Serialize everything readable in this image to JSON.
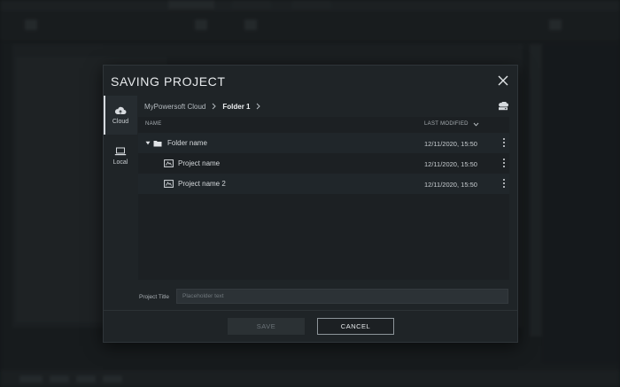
{
  "dialog": {
    "title": "SAVING PROJECT"
  },
  "sidebar": {
    "items": [
      {
        "label": "Cloud",
        "icon": "cloud-icon",
        "active": true
      },
      {
        "label": "Local",
        "icon": "laptop-icon",
        "active": false
      }
    ]
  },
  "breadcrumb": {
    "root": "MyPowersoft Cloud",
    "current": "Folder 1"
  },
  "table": {
    "columns": {
      "name": "NAME",
      "modified": "LAST MODIFIED"
    },
    "rows": [
      {
        "type": "folder",
        "name": "Folder name",
        "modified": "12/11/2020, 15:50"
      },
      {
        "type": "project",
        "name": "Project name",
        "modified": "12/11/2020, 15:50"
      },
      {
        "type": "project",
        "name": "Project name 2",
        "modified": "12/11/2020, 15:50"
      }
    ]
  },
  "form": {
    "project_title_label": "Project Title",
    "project_title_placeholder": "Placeholder text"
  },
  "buttons": {
    "save": "SAVE",
    "cancel": "CANCEL"
  },
  "colors": {
    "dialog_bg": "#1f2427",
    "accent_text": "#eef0f2",
    "cancel_border": "#8d959a"
  }
}
